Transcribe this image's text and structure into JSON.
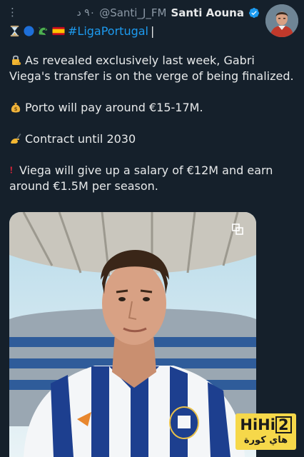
{
  "header": {
    "more_glyph": "⋮",
    "time": "٩٠ د",
    "handle": "@Santi_J_FM",
    "name": "Santi Aouna"
  },
  "tweet": {
    "hashtag": "#LigaPortugal",
    "cursor": "|",
    "paragraphs": [
      {
        "icon": "lock-with-key-icon",
        "text": "As revealed exclusively last week, Gabri Viega's transfer is on the verge of being finalized."
      },
      {
        "icon": "money-bag-icon",
        "text": "Porto will pay around €15-17M."
      },
      {
        "icon": "writing-hand-icon",
        "text": "Contract until 2030"
      },
      {
        "icon": "exclamation-icon",
        "text": "Viega will give up a salary of €12M and earn around €1.5M per season."
      }
    ]
  },
  "watermark": {
    "top_text": "HiHi",
    "top_digit": "2",
    "bottom_text": "هاي كورة"
  },
  "colors": {
    "background": "#15202b",
    "link": "#1d9bf0",
    "muted": "#8b98a5",
    "watermark": "#f6d84a"
  }
}
